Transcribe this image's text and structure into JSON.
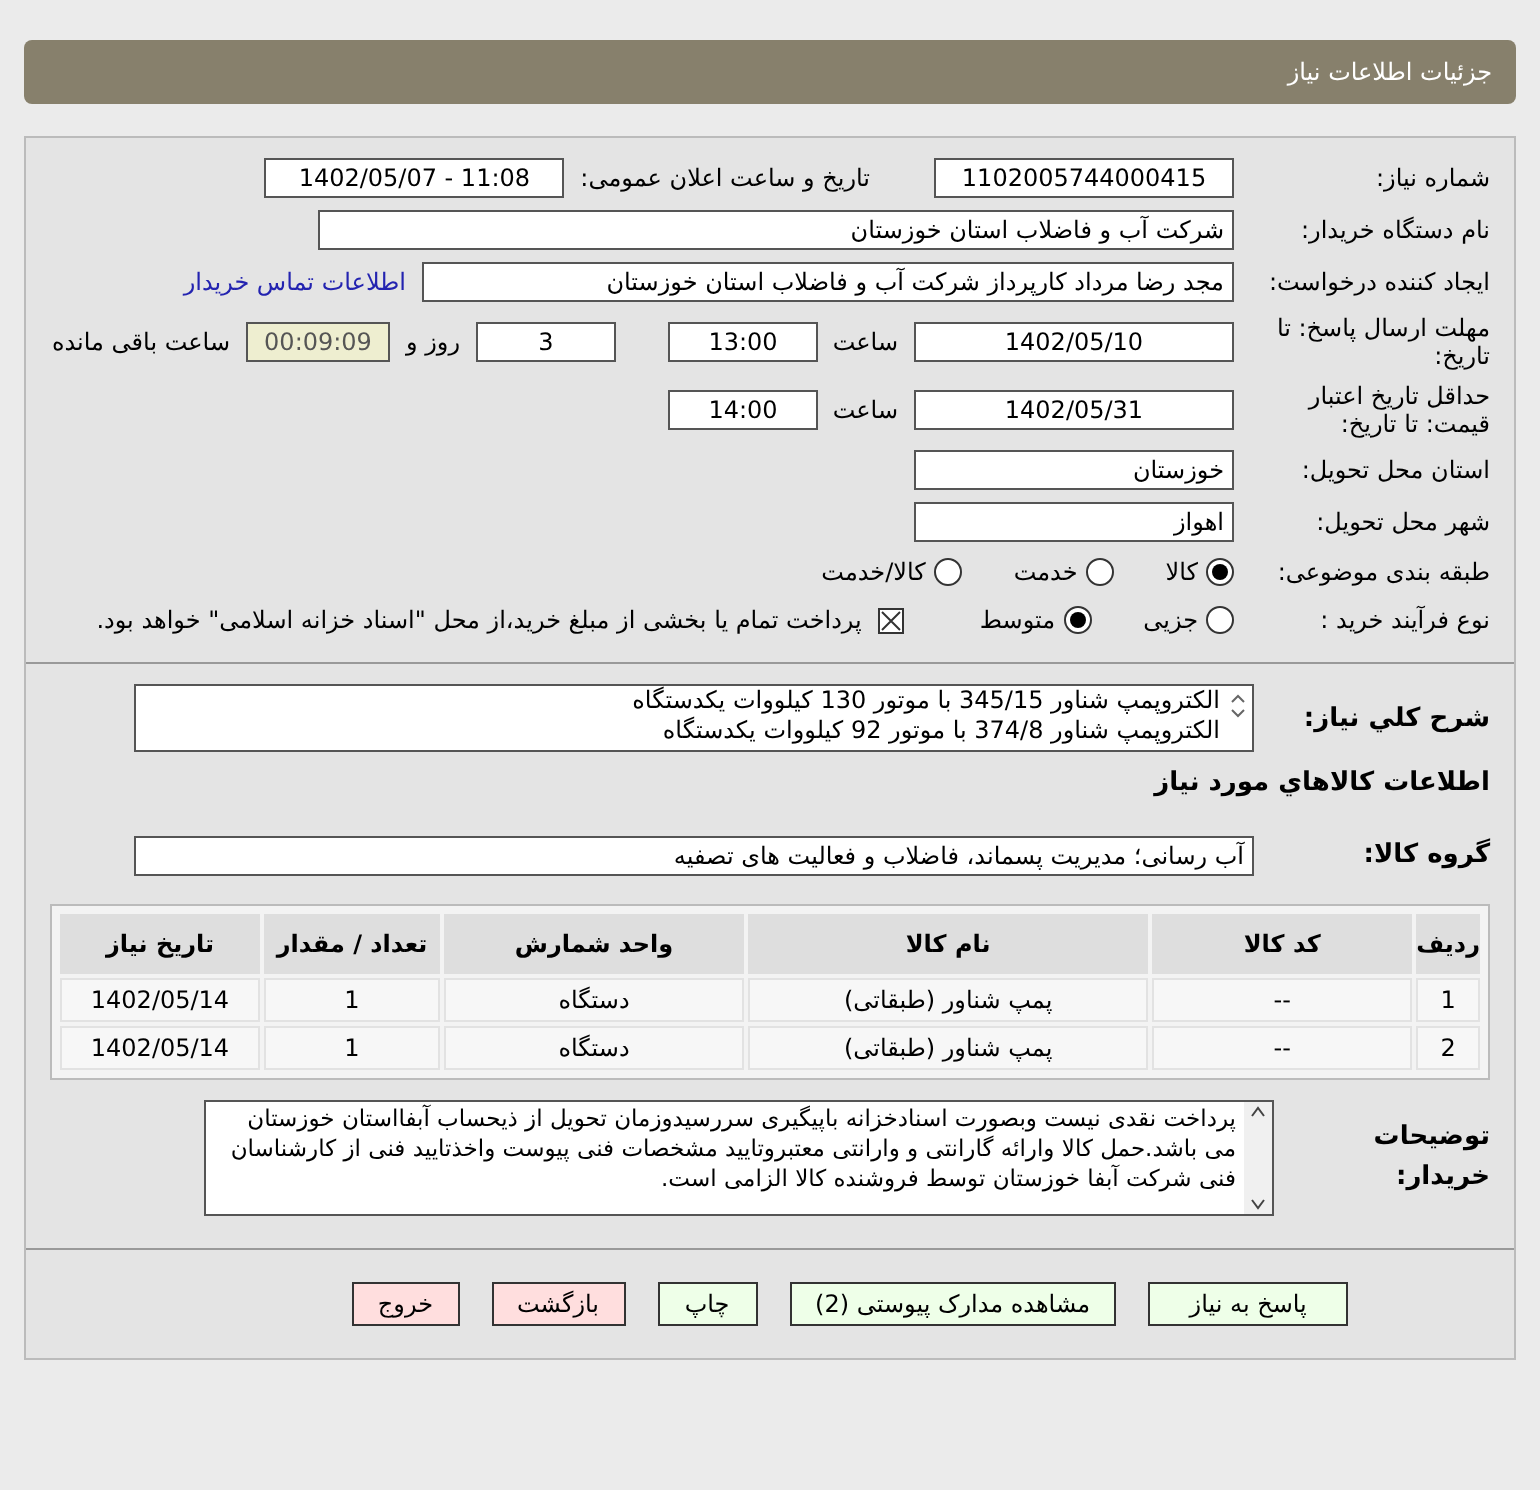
{
  "title": "جزئیات اطلاعات نیاز",
  "need_number": {
    "label": "شماره نیاز:",
    "value": "1102005744000415"
  },
  "announce": {
    "label": "تاریخ و ساعت اعلان عمومی:",
    "value": "1402/05/07 - 11:08"
  },
  "buyer_org": {
    "label": "نام دستگاه خریدار:",
    "value": "شرکت آب و فاضلاب استان خوزستان"
  },
  "requester": {
    "label": "ایجاد کننده درخواست:",
    "value": "مجد رضا مرداد کارپرداز شرکت آب و فاضلاب استان خوزستان",
    "link": "اطلاعات تماس خریدار"
  },
  "deadline": {
    "label": "مهلت ارسال پاسخ: تا تاریخ:",
    "date": "1402/05/10",
    "time_label": "ساعت",
    "time": "13:00",
    "days": "3",
    "days_label": "روز و",
    "remaining": "00:09:09",
    "remaining_label": "ساعت باقی مانده"
  },
  "validity": {
    "label": "حداقل تاریخ اعتبار قیمت: تا تاریخ:",
    "date": "1402/05/31",
    "time_label": "ساعت",
    "time": "14:00"
  },
  "province": {
    "label": "استان محل تحویل:",
    "value": "خوزستان"
  },
  "city": {
    "label": "شهر محل تحویل:",
    "value": "اهواز"
  },
  "category": {
    "label": "طبقه بندی موضوعی:",
    "options": [
      {
        "label": "کالا",
        "selected": true
      },
      {
        "label": "خدمت",
        "selected": false
      },
      {
        "label": "کالا/خدمت",
        "selected": false
      }
    ]
  },
  "process": {
    "label": "نوع فرآیند خرید :",
    "options": [
      {
        "label": "جزیی",
        "selected": false
      },
      {
        "label": "متوسط",
        "selected": true
      }
    ],
    "payment": {
      "checked": true,
      "text": "پرداخت تمام یا بخشی از مبلغ خرید،از محل \"اسناد خزانه اسلامی\" خواهد بود."
    }
  },
  "description": {
    "label": "شرح کلي نياز:",
    "lines": [
      "الکتروپمپ شناور 345/15 با موتور 130 کیلووات یکدستگاه",
      "الکتروپمپ شناور 374/8 با موتور 92 کیلووات یکدستگاه"
    ]
  },
  "goods_heading": "اطلاعات کالاهاي مورد نياز",
  "group": {
    "label": "گروه کالا:",
    "value": "آب رسانی؛ مدیریت پسماند، فاضلاب و فعالیت های تصفیه"
  },
  "table": {
    "columns": [
      "ردیف",
      "کد کالا",
      "نام کالا",
      "واحد شمارش",
      "تعداد / مقدار",
      "تاریخ نیاز"
    ],
    "rows": [
      [
        "1",
        "--",
        "پمپ شناور (طبقاتی)",
        "دستگاه",
        "1",
        "1402/05/14"
      ],
      [
        "2",
        "--",
        "پمپ شناور (طبقاتی)",
        "دستگاه",
        "1",
        "1402/05/14"
      ]
    ]
  },
  "notes": {
    "label": "توضیحات خریدار:",
    "text": "پرداخت نقدی نیست وبصورت اسنادخزانه باپیگیری سررسیدوزمان تحویل از ذیحساب آبفااستان خوزستان می باشد.حمل کالا وارائه گارانتی و وارانتی معتبروتایید مشخصات فنی پیوست واخذتایید فنی از کارشناسان فنی شرکت آبفا خوزستان توسط فروشنده کالا الزامی است."
  },
  "buttons": [
    {
      "label": "پاسخ به نیاز",
      "kind": "normal"
    },
    {
      "label": "مشاهده مدارک پیوستی (2)",
      "kind": "normal"
    },
    {
      "label": "چاپ",
      "kind": "normal"
    },
    {
      "label": "بازگشت",
      "kind": "danger"
    },
    {
      "label": "خروج",
      "kind": "danger"
    }
  ]
}
